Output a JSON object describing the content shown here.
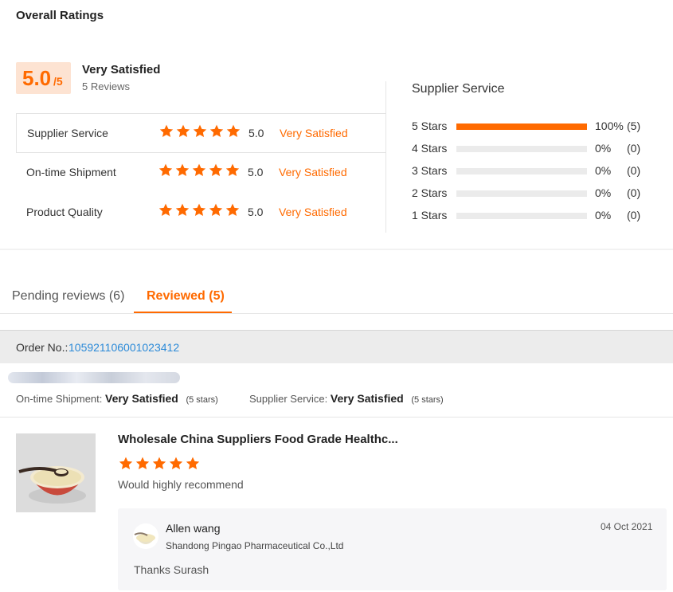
{
  "overall": {
    "title": "Overall Ratings",
    "score": "5.0",
    "score_max": "/5",
    "satisfaction": "Very Satisfied",
    "review_count": "5 Reviews"
  },
  "ratings": [
    {
      "label": "Supplier Service",
      "stars": 5,
      "score": "5.0",
      "satisfaction": "Very Satisfied"
    },
    {
      "label": "On-time Shipment",
      "stars": 5,
      "score": "5.0",
      "satisfaction": "Very Satisfied"
    },
    {
      "label": "Product Quality",
      "stars": 5,
      "score": "5.0",
      "satisfaction": "Very Satisfied"
    }
  ],
  "distribution": {
    "title": "Supplier Service",
    "rows": [
      {
        "label": "5  Stars",
        "fraction": 1.0,
        "percent": "100%",
        "count": "(5)"
      },
      {
        "label": "4  Stars",
        "fraction": 0.0,
        "percent": "0%",
        "count": "(0)"
      },
      {
        "label": "3  Stars",
        "fraction": 0.0,
        "percent": "0%",
        "count": "(0)"
      },
      {
        "label": "2  Stars",
        "fraction": 0.0,
        "percent": "0%",
        "count": "(0)"
      },
      {
        "label": "1  Stars",
        "fraction": 0.0,
        "percent": "0%",
        "count": "(0)"
      }
    ]
  },
  "tabs": {
    "pending": "Pending reviews (6)",
    "reviewed": "Reviewed (5)"
  },
  "order": {
    "label": "Order No.:",
    "number": "105921106001023412"
  },
  "review": {
    "shipment_label": "On-time Shipment:",
    "shipment_value": "Very Satisfied",
    "shipment_stars": "(5 stars)",
    "service_label": "Supplier Service:",
    "service_value": "Very Satisfied",
    "service_stars": "(5 stars)",
    "product_title": "Wholesale China Suppliers Food Grade Healthc...",
    "product_stars": 5,
    "comment": "Would highly recommend",
    "reply": {
      "name": "Allen wang",
      "company": "Shandong Pingao Pharmaceutical Co.,Ltd",
      "date": "04 Oct 2021",
      "text": "Thanks Surash"
    }
  },
  "colors": {
    "accent": "#ff6a00",
    "link": "#2b8ad8",
    "score_bg": "#fde3d2"
  }
}
